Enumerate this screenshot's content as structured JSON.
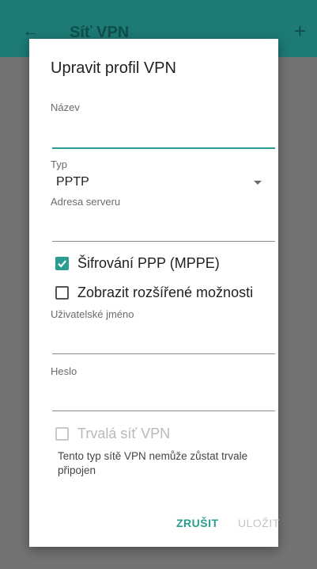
{
  "background": {
    "back_icon": "←",
    "title": "Síť VPN",
    "add_icon": "+"
  },
  "dialog": {
    "title": "Upravit profil VPN",
    "name_label": "Název",
    "name_value": "",
    "type_label": "Typ",
    "type_value": "PPTP",
    "server_label": "Adresa serveru",
    "server_value": "",
    "mppe_label": "Šifrování PPP (MPPE)",
    "mppe_checked": true,
    "advanced_label": "Zobrazit rozšířené možnosti",
    "advanced_checked": false,
    "username_label": "Uživatelské jméno",
    "username_value": "",
    "password_label": "Heslo",
    "password_value": "",
    "always_on_label": "Trvalá síť VPN",
    "always_on_checked": false,
    "always_on_note": "Tento typ sítě VPN nemůže zůstat trvale připojen",
    "cancel_label": "ZRUŠIT",
    "save_label": "ULOŽIT"
  },
  "colors": {
    "accent": "#2a9d91",
    "disabled": "#c4c4c4"
  }
}
